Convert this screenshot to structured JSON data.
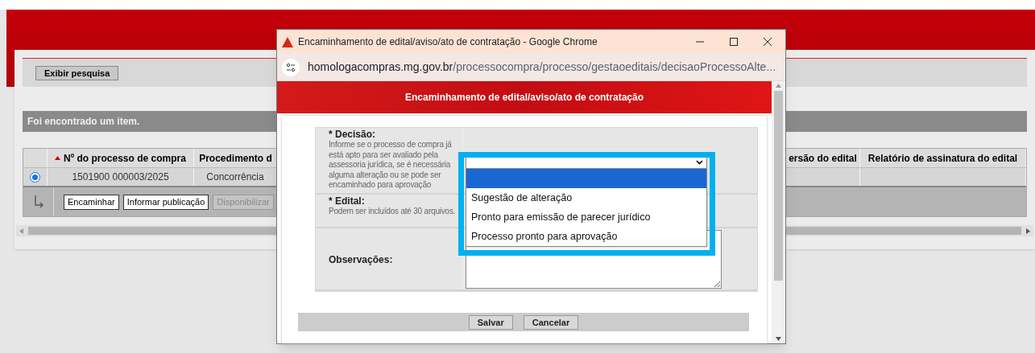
{
  "page": {
    "search_button": "Exibir pesquisa",
    "result_message": "Foi encontrado um item.",
    "table": {
      "columns": [
        {
          "label": "Nº do processo de compra",
          "sorted": true
        },
        {
          "label": "Procedimento d",
          "sorted": false
        },
        {
          "label": "ersão do edital",
          "sorted": false
        },
        {
          "label": "Relatório de assinatura do edital",
          "sorted": false
        }
      ],
      "rows": [
        {
          "selected": true,
          "cells": [
            "1501900 000003/2025",
            "Concorrência"
          ]
        }
      ]
    },
    "actions": [
      {
        "label": "Encaminhar",
        "disabled": false
      },
      {
        "label": "Informar publicação",
        "disabled": false
      },
      {
        "label": "Disponibilizar",
        "disabled": true
      }
    ]
  },
  "popup": {
    "window_title": "Encaminhamento de edital/aviso/ato de contratação - Google Chrome",
    "url_host": "homologacompras.mg.gov.br",
    "url_path": "/processocompra/processo/gestaoeditais/decisaoProcessoAlte...",
    "header": "Encaminhamento de edital/aviso/ato de contratação",
    "fields": [
      {
        "kind": "select",
        "label": "* Decisão:",
        "hint": "Informe se o processo de compra já está apto para ser avaliado pela assessoria jurídica, se é necessária alguma alteração ou se pode ser encaminhado para aprovação"
      },
      {
        "kind": "files",
        "label": "* Edital:",
        "hint": "Podem ser incluídos até 30 arquivos."
      },
      {
        "kind": "textarea",
        "label": "Observações:"
      }
    ],
    "options": [
      {
        "selected": true
      },
      {
        "label": "Sugestão de alteração",
        "selected": false
      },
      {
        "label": "Pronto para emissão de parecer jurídico",
        "selected": false
      },
      {
        "label": "Processo pronto para aprovação",
        "selected": false
      }
    ],
    "buttons": [
      "Salvar",
      "Cancelar"
    ]
  }
}
